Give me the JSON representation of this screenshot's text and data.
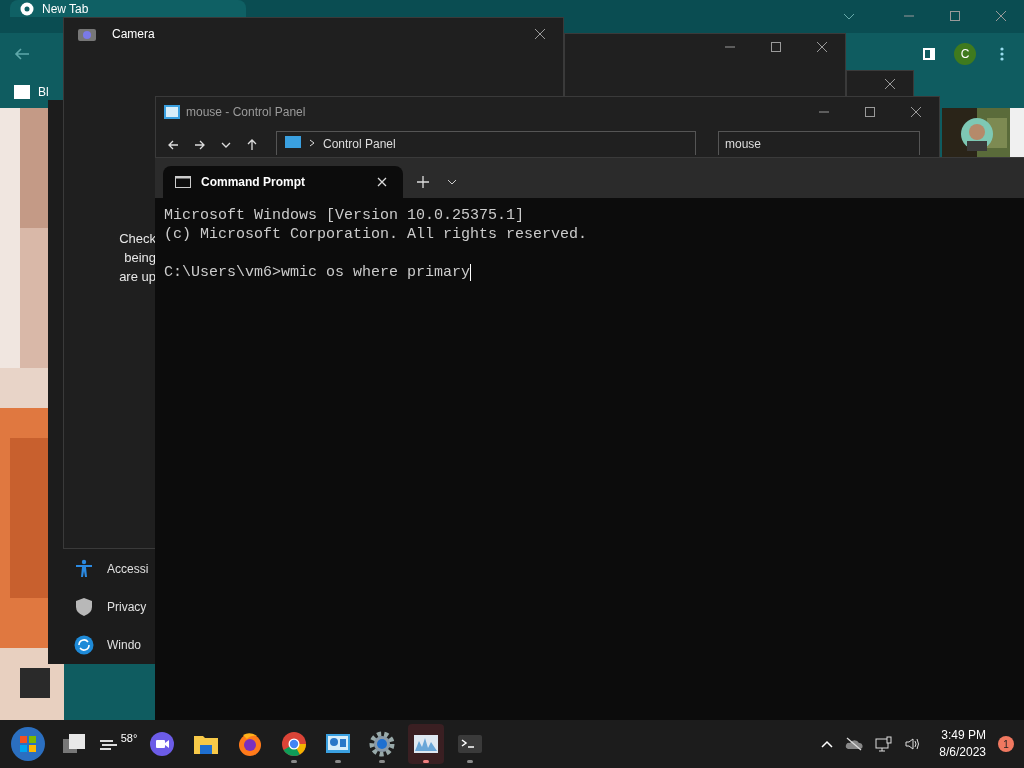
{
  "browser": {
    "tab_title": "New Tab",
    "bookmark": "Bl",
    "profile": "C"
  },
  "back_windows": [
    {
      "kind": "full"
    },
    {
      "kind": "close"
    }
  ],
  "settings": {
    "items": [
      {
        "kind": "accessibility",
        "label": "Accessi"
      },
      {
        "kind": "privacy",
        "label": "Privacy"
      },
      {
        "kind": "update",
        "label": "Windo"
      }
    ]
  },
  "camera": {
    "title": "Camera",
    "lines": [
      "Check",
      "being",
      "are up"
    ]
  },
  "control_panel": {
    "title": "mouse - Control Panel",
    "address": "Control Panel",
    "search": "mouse"
  },
  "terminal": {
    "tab_title": "Command Prompt",
    "lines": [
      "Microsoft Windows [Version 10.0.25375.1]",
      "(c) Microsoft Corporation. All rights reserved."
    ],
    "prompt": "C:\\Users\\vm6>wmic os where primary"
  },
  "taskbar": {
    "weather": "58°",
    "apps": [
      {
        "kind": "taskview",
        "running": false,
        "selected": false
      },
      {
        "kind": "weather",
        "running": false,
        "selected": false
      },
      {
        "kind": "meet",
        "running": false,
        "selected": false
      },
      {
        "kind": "explorer",
        "running": false,
        "selected": false
      },
      {
        "kind": "firefox",
        "running": false,
        "selected": false
      },
      {
        "kind": "chrome",
        "running": true,
        "selected": false
      },
      {
        "kind": "controlpanel",
        "running": true,
        "selected": false
      },
      {
        "kind": "settings",
        "running": true,
        "selected": false
      },
      {
        "kind": "monitor",
        "running": true,
        "selected": true
      },
      {
        "kind": "terminal",
        "running": true,
        "selected": false
      }
    ],
    "time": "3:49 PM",
    "date": "8/6/2023",
    "notifications": "1"
  }
}
